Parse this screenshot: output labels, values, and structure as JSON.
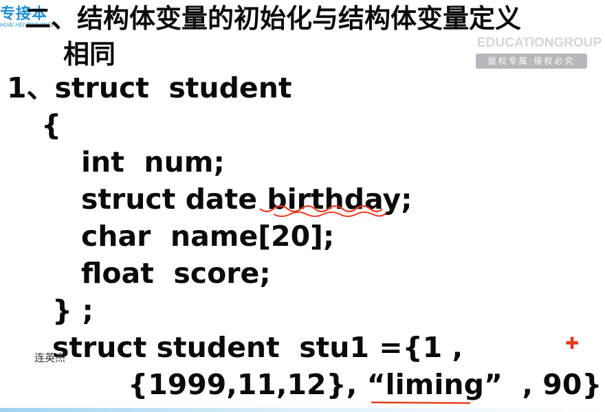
{
  "logo": {
    "main": "专接本",
    "sub": "HUAI HEI PROVINCE"
  },
  "title": {
    "line1": "二、结构体变量的初始化与结构体变量定义",
    "line2": "相同"
  },
  "watermark": {
    "english": "EDUCATIONGROUP",
    "chinese": "版权专属·侵权必究"
  },
  "code": {
    "line1": "1、struct  student",
    "line2": "{",
    "line3": "int  num;",
    "line4": "struct date birthday;",
    "line5": "char  name[20];",
    "line6": "float  score;",
    "line7": "} ;",
    "line8": "struct student  stu1 ={1 ,",
    "line9": "{1999,11,12}, “liming”  , 90} ;"
  },
  "speaker_name": "连英杰",
  "annotation_color": "#e8391d",
  "accent_color": "#1e8fd6"
}
